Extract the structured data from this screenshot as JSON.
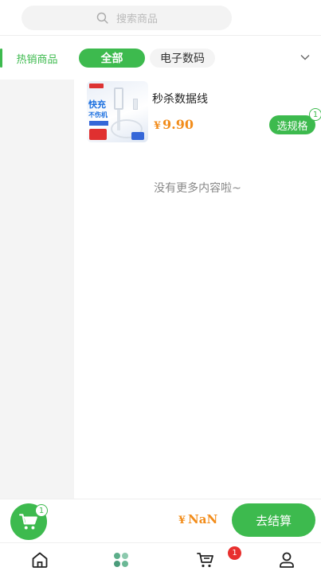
{
  "search": {
    "placeholder": "搜索商品",
    "icon": "search-icon"
  },
  "sidebar": {
    "items": [
      {
        "label": "热销商品",
        "active": true
      }
    ]
  },
  "category_tabs": [
    {
      "label": "全部",
      "active": true
    },
    {
      "label": "电子数码",
      "active": false
    }
  ],
  "products": [
    {
      "name": "秒杀数据线",
      "currency": "¥",
      "price": "9.90",
      "action_label": "选规格",
      "selected_count": "1",
      "thumb_text_1": "快充",
      "thumb_text_2": "不伤机"
    }
  ],
  "list_footer": "没有更多内容啦~",
  "checkout": {
    "cart_count": "1",
    "currency": "¥",
    "total": "NaN",
    "pay_label": "去结算"
  },
  "bottom_nav": {
    "items": [
      {
        "icon": "home-icon"
      },
      {
        "icon": "category-icon",
        "active": true
      },
      {
        "icon": "cart-icon",
        "badge": "1"
      },
      {
        "icon": "user-icon"
      }
    ]
  },
  "colors": {
    "accent": "#3dba4e",
    "price": "#f28c1a",
    "badge": "#e8302e"
  }
}
